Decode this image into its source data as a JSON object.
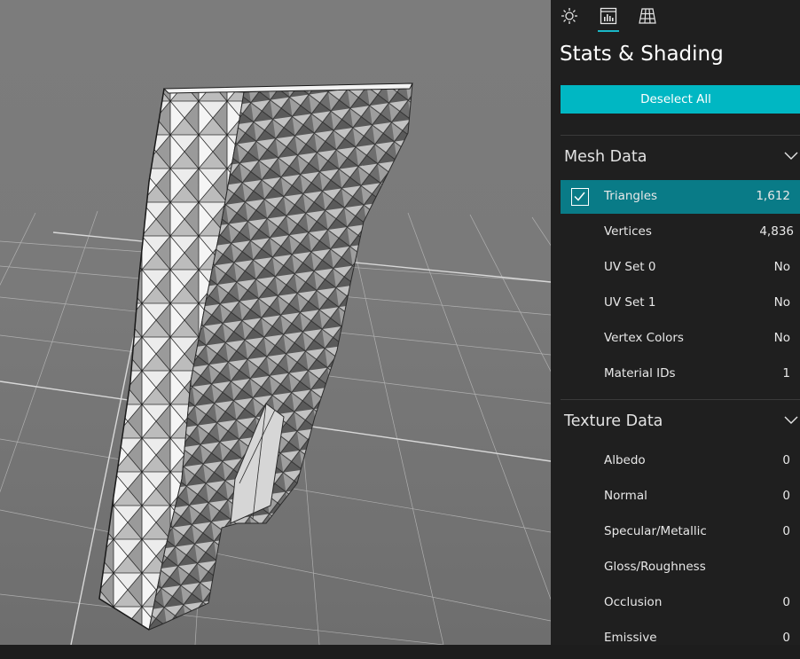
{
  "tabs": [
    {
      "icon": "sun-icon",
      "active": false
    },
    {
      "icon": "stats-chart-icon",
      "active": true
    },
    {
      "icon": "grid-icon",
      "active": false
    }
  ],
  "panel": {
    "title": "Stats & Shading",
    "deselect_label": "Deselect All"
  },
  "mesh_data": {
    "header": "Mesh Data",
    "rows": [
      {
        "label": "Triangles",
        "value": "1,612",
        "checked": true
      },
      {
        "label": "Vertices",
        "value": "4,836"
      },
      {
        "label": "UV Set 0",
        "value": "No"
      },
      {
        "label": "UV Set 1",
        "value": "No"
      },
      {
        "label": "Vertex Colors",
        "value": "No"
      },
      {
        "label": "Material IDs",
        "value": "1"
      }
    ]
  },
  "texture_data": {
    "header": "Texture Data",
    "rows": [
      {
        "label": "Albedo",
        "value": "0"
      },
      {
        "label": "Normal",
        "value": "0"
      },
      {
        "label": "Specular/Metallic",
        "value": "0"
      },
      {
        "label": "Gloss/Roughness",
        "value": ""
      },
      {
        "label": "Occlusion",
        "value": "0"
      },
      {
        "label": "Emissive",
        "value": "0"
      }
    ]
  },
  "colors": {
    "accent": "#00b7c3",
    "selected_row": "#097b87",
    "panel_bg": "#1f1f1f"
  }
}
